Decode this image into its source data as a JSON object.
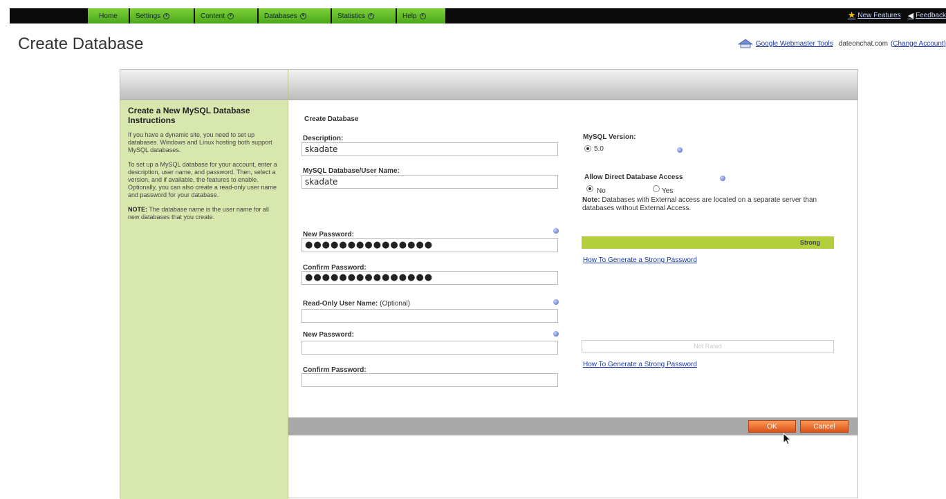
{
  "nav": {
    "tabs": [
      {
        "label": "Home"
      },
      {
        "label": "Settings"
      },
      {
        "label": "Content"
      },
      {
        "label": "Databases"
      },
      {
        "label": "Statistics"
      },
      {
        "label": "Help"
      }
    ],
    "new_features": "New Features",
    "feedback": "Feedback"
  },
  "header": {
    "title": "Create Database",
    "gwt_link": "Google Webmaster Tools",
    "domain": "dateonchat.com",
    "change_account": "(Change Account)"
  },
  "sidebar": {
    "title": "Create a New MySQL Database Instructions",
    "p1": "If you have a dynamic site, you need to set up databases. Windows and Linux hosting both support MySQL databases.",
    "p2": "To set up a MySQL database for your account, enter a description, user name, and password. Then, select a version, and if available, the features to enable. Optionally, you can also create a read-only user name and password for your database.",
    "note_label": "NOTE:",
    "note_text": " The database name is the user name for all new databases that you create."
  },
  "form": {
    "section_title": "Create Database",
    "description_label": "Description:",
    "description_value": "skadate",
    "username_label": "MySQL Database/User Name:",
    "username_value": "skadate",
    "new_password_label": "New Password:",
    "new_password_value": "●●●●●●●●●●●●●●●",
    "confirm_password_label": "Confirm Password:",
    "confirm_password_value": "●●●●●●●●●●●●●●●",
    "ro_username_label": "Read-Only User Name:",
    "ro_username_optional": " (Optional)",
    "ro_username_value": "",
    "ro_new_password_label": "New Password:",
    "ro_new_password_value": "",
    "ro_confirm_password_label": "Confirm Password:",
    "ro_confirm_password_value": ""
  },
  "options": {
    "mysql_version_label": "MySQL Version:",
    "version_value": "5.0",
    "direct_access_label": "Allow Direct Database Access",
    "no_label": "No",
    "yes_label": "Yes",
    "note_label": "Note:",
    "note_text": " Databases with External access are located on a separate server than databases without External Access.",
    "strength_1": "Strong",
    "strength_2": "Not Rated",
    "pw_link_1": "How To Generate a Strong Password",
    "pw_link_2": "How To Generate a Strong Password"
  },
  "buttons": {
    "ok": "OK",
    "cancel": "Cancel"
  },
  "colors": {
    "nav_green": "#5cb826",
    "sidebar_bg": "#d8e7ad",
    "strength_strong": "#b3cf3b",
    "button_orange": "#e8672a"
  }
}
